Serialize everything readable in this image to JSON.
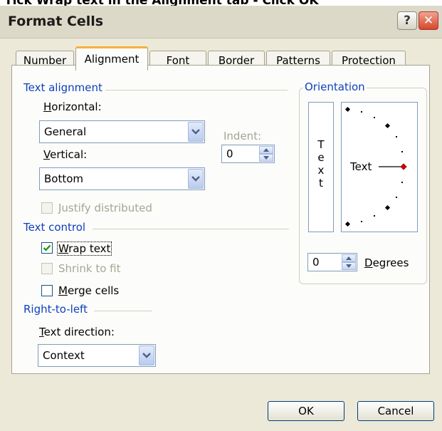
{
  "caption": "Tick Wrap text in the Alignment tab - Click OK",
  "window": {
    "title": "Format Cells",
    "help_symbol": "?",
    "close_symbol": "✕"
  },
  "tabs": [
    {
      "label": "Number",
      "active": false
    },
    {
      "label": "Alignment",
      "active": true
    },
    {
      "label": "Font",
      "active": false
    },
    {
      "label": "Border",
      "active": false
    },
    {
      "label": "Patterns",
      "active": false
    },
    {
      "label": "Protection",
      "active": false
    }
  ],
  "text_alignment": {
    "group_label": "Text alignment",
    "horizontal_label_u": "H",
    "horizontal_label_rest": "orizontal:",
    "horizontal_value": "General",
    "vertical_label_u": "V",
    "vertical_label_rest": "ertical:",
    "vertical_value": "Bottom",
    "indent_label": "Indent:",
    "indent_value": "0",
    "justify_label": "Justify distributed"
  },
  "text_control": {
    "group_label": "Text control",
    "wrap_u": "W",
    "wrap_rest": "rap text",
    "wrap_checked": true,
    "shrink_label": "Shrink to fit",
    "merge_u": "M",
    "merge_rest": "erge cells",
    "merge_checked": false
  },
  "rtl": {
    "group_label": "Right-to-left",
    "direction_label_u": "T",
    "direction_label_rest": "ext direction:",
    "direction_value": "Context"
  },
  "orientation": {
    "group_label": "Orientation",
    "vertical_letters": [
      "T",
      "e",
      "x",
      "t"
    ],
    "dial_text": "Text",
    "degrees_value": "0",
    "degrees_label_u": "D",
    "degrees_label_rest": "egrees"
  },
  "buttons": {
    "ok": "OK",
    "cancel": "Cancel"
  },
  "colors": {
    "group_label": "#0f3fbd",
    "active_tab_accent": "#f6b13d",
    "dial_marker": "#d40000"
  }
}
